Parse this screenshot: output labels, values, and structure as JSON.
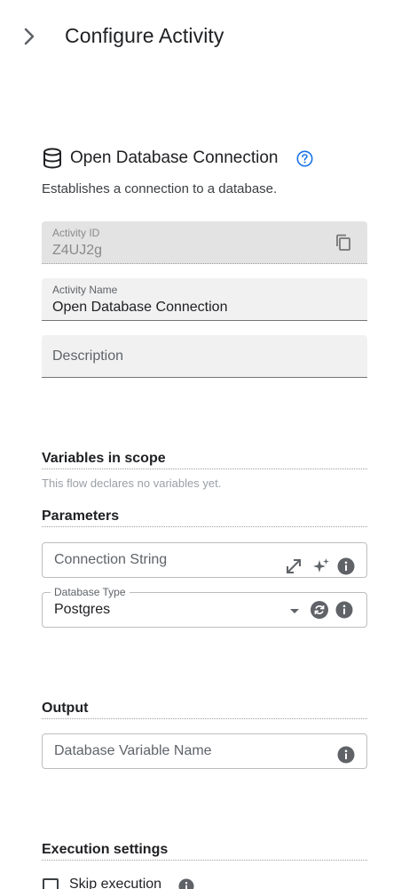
{
  "header": {
    "title": "Configure Activity",
    "toggle_icon": "chevron-right-icon"
  },
  "activity": {
    "icon": "database-icon",
    "title": "Open Database Connection",
    "help_icon": "help-circle-icon",
    "description": "Establishes a connection to a database."
  },
  "fields": {
    "activity_id": {
      "label": "Activity ID",
      "value": "Z4UJ2g",
      "disabled": true,
      "action_icon": "copy-icon"
    },
    "activity_name": {
      "label": "Activity Name",
      "value": "Open Database Connection"
    },
    "description": {
      "placeholder": "Description"
    }
  },
  "variables": {
    "heading": "Variables in scope",
    "empty_text": "This flow declares no variables yet."
  },
  "parameters": {
    "heading": "Parameters",
    "connection_string": {
      "placeholder": "Connection String",
      "icons": [
        "expand-icon",
        "sparkle-icon",
        "info-icon"
      ]
    },
    "database_type": {
      "label": "Database Type",
      "value": "Postgres",
      "icons": [
        "dropdown-arrow-icon",
        "refresh-icon",
        "info-icon"
      ]
    }
  },
  "output": {
    "heading": "Output",
    "database_variable_name": {
      "placeholder": "Database Variable Name",
      "icons": [
        "info-icon"
      ]
    }
  },
  "execution": {
    "heading": "Execution settings",
    "skip_execution": {
      "label": "Skip execution",
      "checked": false
    }
  },
  "colors": {
    "accent": "#1a73e8",
    "icon_dark": "#5f6368",
    "field_bg": "#f1f1f1",
    "disabled_bg": "#e3e3e3"
  }
}
